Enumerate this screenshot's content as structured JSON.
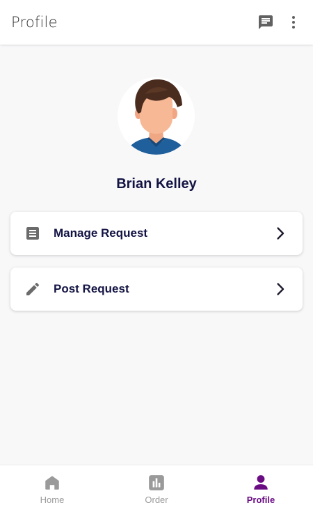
{
  "app_bar": {
    "title": "Profile",
    "actions": [
      {
        "icon": "chat-icon"
      },
      {
        "icon": "more-vert-icon"
      }
    ]
  },
  "profile": {
    "name": "Brian Kelley",
    "avatar_icon": "avatar-illustration"
  },
  "menu": [
    {
      "label": "Manage Request",
      "icon": "list-alt-icon"
    },
    {
      "label": "Post Request",
      "icon": "pencil-icon"
    }
  ],
  "bottom_nav": {
    "items": [
      {
        "label": "Home",
        "icon": "home-icon",
        "active": false
      },
      {
        "label": "Order",
        "icon": "bar-chart-icon",
        "active": false
      },
      {
        "label": "Profile",
        "icon": "person-icon",
        "active": true
      }
    ]
  },
  "colors": {
    "accent": "#6a0d83",
    "text_dark": "#141444",
    "inactive": "#9a9a9a",
    "background": "#f8f8f9"
  }
}
